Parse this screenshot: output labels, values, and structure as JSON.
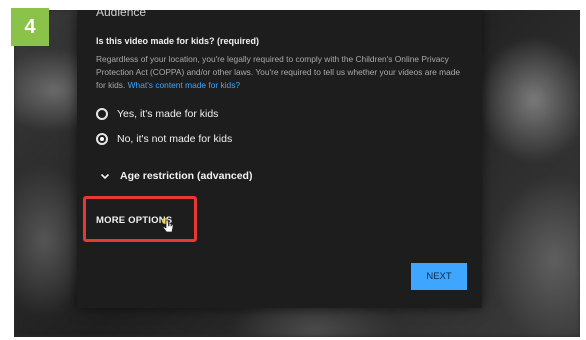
{
  "step_badge": "4",
  "dialog": {
    "section_title": "Audience",
    "question": "Is this video made for kids? (required)",
    "description": "Regardless of your location, you're legally required to comply with the Children's Online Privacy Protection Act (COPPA) and/or other laws. You're required to tell us whether your videos are made for kids.",
    "description_link": "What's content made for kids?",
    "options": [
      {
        "label": "Yes, it's made for kids",
        "selected": false
      },
      {
        "label": "No, it's not made for kids",
        "selected": true
      }
    ],
    "age_restriction_label": "Age restriction (advanced)",
    "more_options_label": "MORE OPTIONS",
    "next_label": "NEXT"
  },
  "colors": {
    "accent_blue": "#3ea6ff",
    "highlight_red": "#e53935",
    "badge_green": "#8bc34a",
    "dialog_bg": "#1d1d1d"
  },
  "icons": [
    "radio-unchecked-icon",
    "radio-checked-icon",
    "chevron-down-icon",
    "hand-cursor-icon"
  ]
}
